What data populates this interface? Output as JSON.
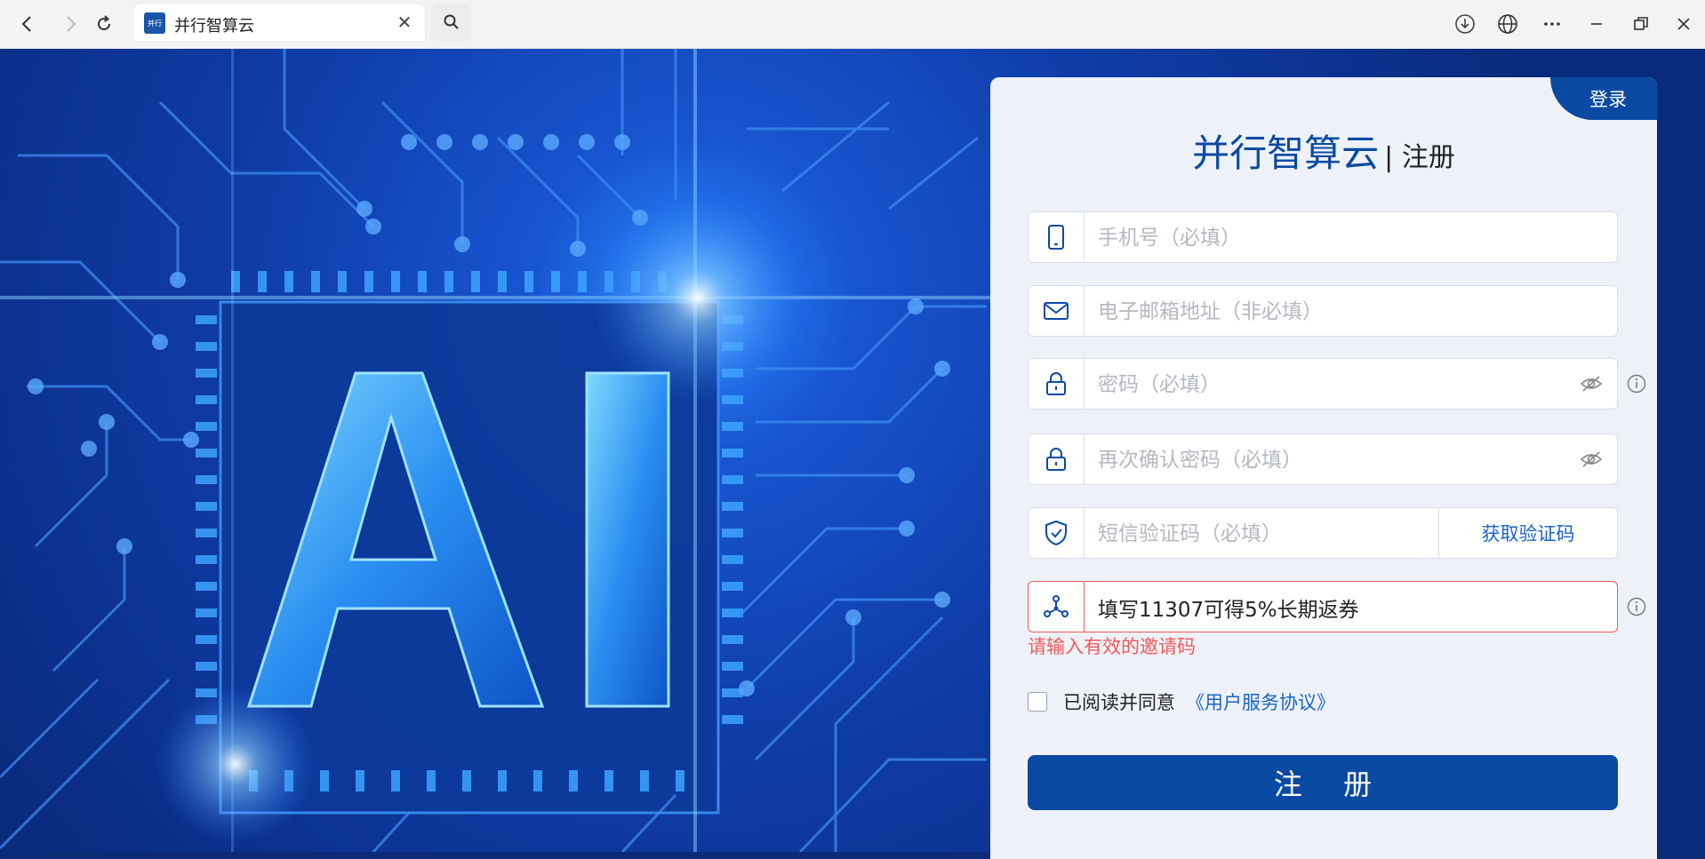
{
  "browser": {
    "tab_title": "并行智算云",
    "favicon_text": "并行"
  },
  "card": {
    "login_tab": "登录",
    "title": "并行智算云",
    "subtitle": "| 注册",
    "fields": {
      "phone_placeholder": "手机号（必填）",
      "email_placeholder": "电子邮箱地址（非必填）",
      "password_placeholder": "密码（必填）",
      "confirm_placeholder": "再次确认密码（必填）",
      "sms_placeholder": "短信验证码（必填）",
      "invite_value": "填写11307可得5%长期返券"
    },
    "get_code_label": "获取验证码",
    "invite_error": "请输入有效的邀请码",
    "agree_text": "已阅读并同意",
    "agree_link": "《用户服务协议》",
    "submit_label": "注 册"
  },
  "background": {
    "big_text": "AI"
  },
  "colors": {
    "brand": "#0b4aa3",
    "link": "#1a63c8",
    "error": "#f05a5a"
  }
}
